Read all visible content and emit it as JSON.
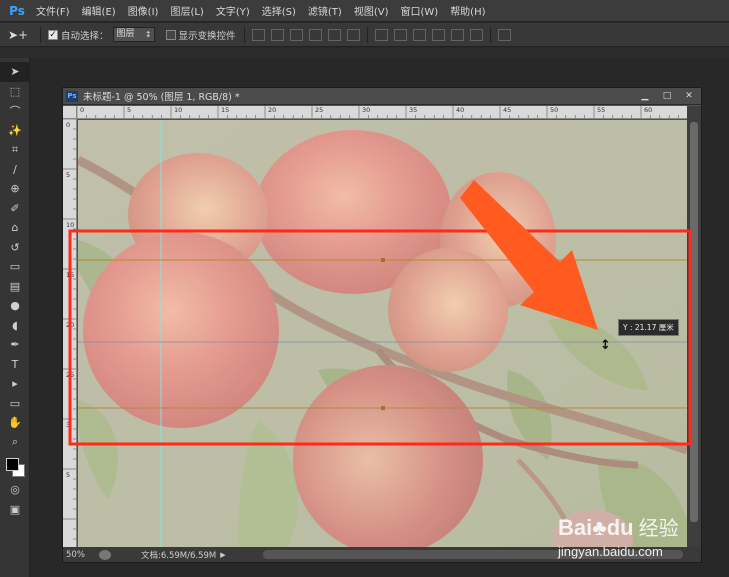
{
  "app": {
    "logo": "Ps"
  },
  "menu": [
    "文件(F)",
    "编辑(E)",
    "图像(I)",
    "图层(L)",
    "文字(Y)",
    "选择(S)",
    "滤镜(T)",
    "视图(V)",
    "窗口(W)",
    "帮助(H)"
  ],
  "options": {
    "tool_icon": "move-tool-icon",
    "auto_select_label": "自动选择：",
    "auto_select_checked": true,
    "auto_select_target": "图层",
    "show_transform_label": "显示变换控件",
    "show_transform_checked": false
  },
  "document": {
    "title": "未标题-1 @ 50% (图层 1, RGB/8) *",
    "ruler_top": [
      "0",
      "5",
      "10",
      "15",
      "20",
      "25",
      "30",
      "35",
      "40",
      "45",
      "50",
      "55",
      "60"
    ],
    "ruler_left": [
      "0",
      "5",
      "10",
      "15",
      "20",
      "25",
      "3",
      "5"
    ],
    "zoom": "50%",
    "doc_info": "文档:6.59M/6.59M",
    "readout": "Y : 21.17 厘米",
    "colors": {
      "highlight_box": "#ff2a1a",
      "arrow": "#ff5a1f",
      "guide": "#b08a3a"
    }
  },
  "watermark": {
    "logo": "Bai",
    "logo2": "du",
    "cn": "经验",
    "url": "jingyan.baidu.com"
  }
}
